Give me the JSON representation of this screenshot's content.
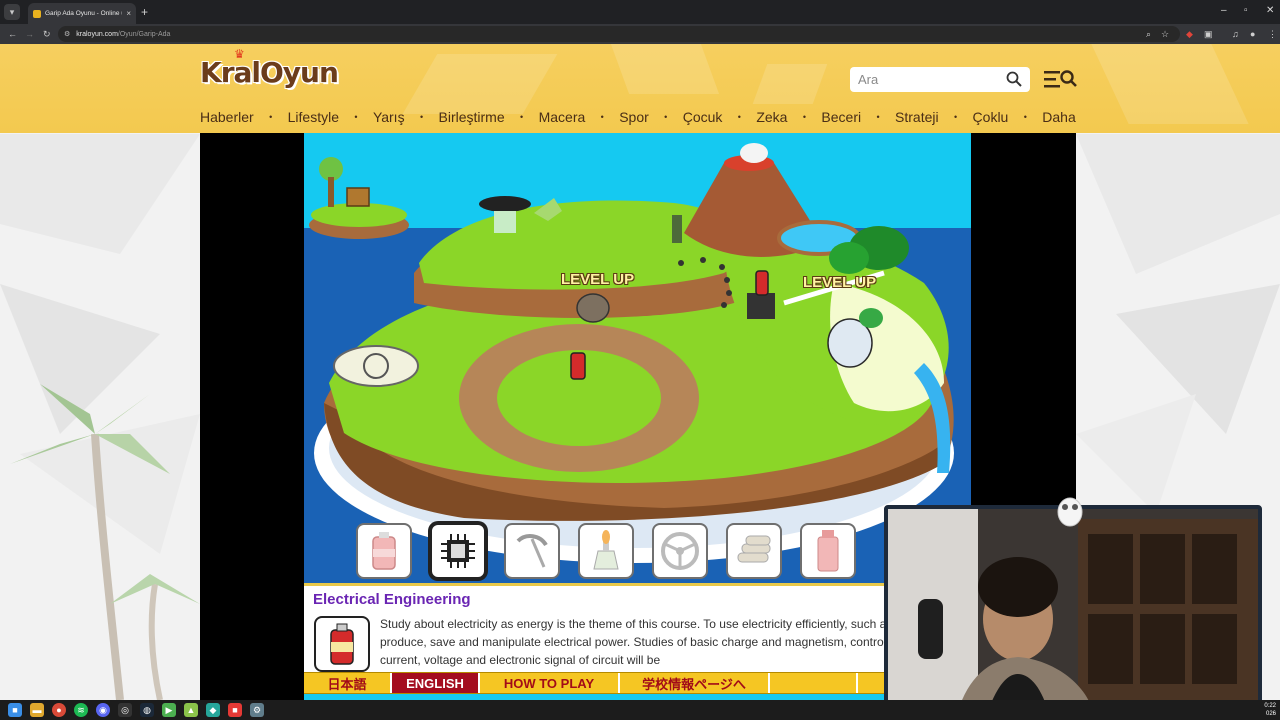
{
  "browser": {
    "tab_title": "Garip Ada Oyunu - Online ücre",
    "tab_close": "×",
    "new_tab": "+",
    "url_host": "kraloyun.com",
    "url_path": "/Oyun/Garip-Ada"
  },
  "header": {
    "logo": "KralOyun",
    "search_placeholder": "Ara",
    "nav": [
      "Haberler",
      "Lifestyle",
      "Yarış",
      "Birleştirme",
      "Macera",
      "Spor",
      "Çocuk",
      "Zeka",
      "Beceri",
      "Strateji",
      "Çoklu",
      "Daha"
    ],
    "nav_separator": "•"
  },
  "game": {
    "level_up_1": "LEVEL UP",
    "level_up_2": "LEVEL UP",
    "items": [
      "battery-item",
      "chip-item",
      "pickaxe-item",
      "flask-item",
      "steering-wheel-item",
      "logs-item",
      "canister-item"
    ],
    "course_title": "Electrical Engineering",
    "course_description": "Study about electricity as energy is the theme of this course.  To use electricity efficiently, such as how to produce, save and manipulate electrical power.  Studies of basic charge and magnetism, control of electric current, voltage and electronic signal of circuit will be",
    "bottom_bar": [
      "日本語",
      "ENGLISH",
      "HOW TO PLAY",
      "学校情報ページへ",
      ""
    ]
  },
  "colors": {
    "header_yellow": "#f3c94f",
    "nav_text": "#4a2e16",
    "course_title": "#6a25b3",
    "bottom_bar": "#f5c623",
    "bottom_active": "#a40c1f",
    "sea": "#15c9f1",
    "grass": "#8bd628"
  },
  "taskbar": {
    "clock_time": "0:22",
    "clock_date": "026"
  }
}
